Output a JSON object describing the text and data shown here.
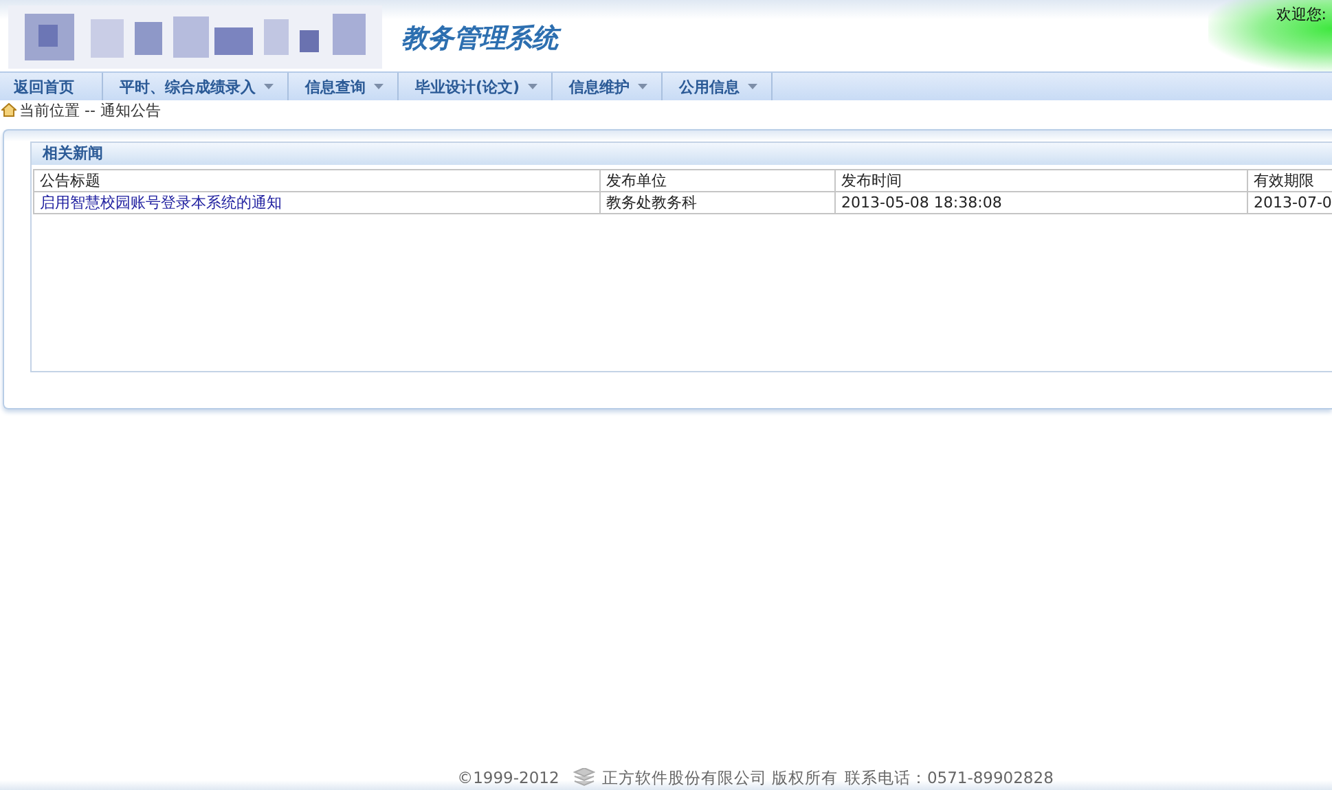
{
  "header": {
    "title": "教务管理系统",
    "welcome": "欢迎您:"
  },
  "nav": [
    {
      "label": "返回首页",
      "dropdown": false
    },
    {
      "label": "平时、综合成绩录入",
      "dropdown": true
    },
    {
      "label": "信息查询",
      "dropdown": true
    },
    {
      "label": "毕业设计(论文)",
      "dropdown": true
    },
    {
      "label": "信息维护",
      "dropdown": true
    },
    {
      "label": "公用信息",
      "dropdown": true
    }
  ],
  "breadcrumb": "当前位置 -- 通知公告",
  "news": {
    "title": "相关新闻",
    "columns": [
      "公告标题",
      "发布单位",
      "发布时间",
      "有效期限"
    ],
    "rows": [
      {
        "cells": [
          "启用智慧校园账号登录本系统的通知",
          "教务处教务科",
          "2013-05-08 18:38:08",
          "2013-07-0"
        ]
      }
    ]
  },
  "footer": {
    "copyright": "©1999-2012",
    "company": "正方软件股份有限公司 版权所有",
    "phone": "联系电话：0571-89902828"
  }
}
